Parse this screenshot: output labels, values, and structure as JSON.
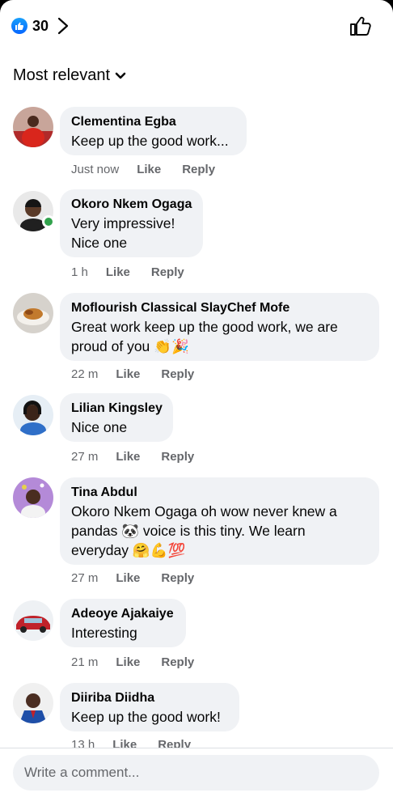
{
  "header": {
    "reaction_count": "30",
    "reaction_icon": "like-icon",
    "colors": {
      "like_blue": "#1877f2"
    }
  },
  "sort": {
    "label": "Most relevant"
  },
  "comments": [
    {
      "author": "Clementina Egba",
      "text": "Keep up the good work...",
      "time": "Just now",
      "like": "Like",
      "reply": "Reply"
    },
    {
      "author": "Okoro Nkem Ogaga",
      "text_lines": [
        "Very impressive!",
        "Nice one"
      ],
      "time": "1 h",
      "like": "Like",
      "reply": "Reply"
    },
    {
      "author": "Moflourish Classical SlayChef Mofe",
      "text_lines": [
        "Great work keep up the good work, we are",
        "proud of you 👏🎉"
      ],
      "time": "22 m",
      "like": "Like",
      "reply": "Reply"
    },
    {
      "author": "Lilian Kingsley",
      "text": "Nice one",
      "time": "27 m",
      "like": "Like",
      "reply": "Reply"
    },
    {
      "author": "Tina Abdul",
      "text_lines": [
        "Okoro Nkem Ogaga oh wow never knew a",
        "pandas 🐼 voice is this tiny. We learn",
        "everyday 🤗💪💯"
      ],
      "time": "27 m",
      "like": "Like",
      "reply": "Reply"
    },
    {
      "author": "Adeoye Ajakaiye",
      "text": "Interesting",
      "time": "21 m",
      "like": "Like",
      "reply": "Reply"
    },
    {
      "author": "Diiriba Diidha",
      "text": "Keep up the good work!",
      "time": "13 h",
      "like": "Like",
      "reply": "Reply"
    }
  ],
  "composer": {
    "placeholder": "Write a comment..."
  }
}
